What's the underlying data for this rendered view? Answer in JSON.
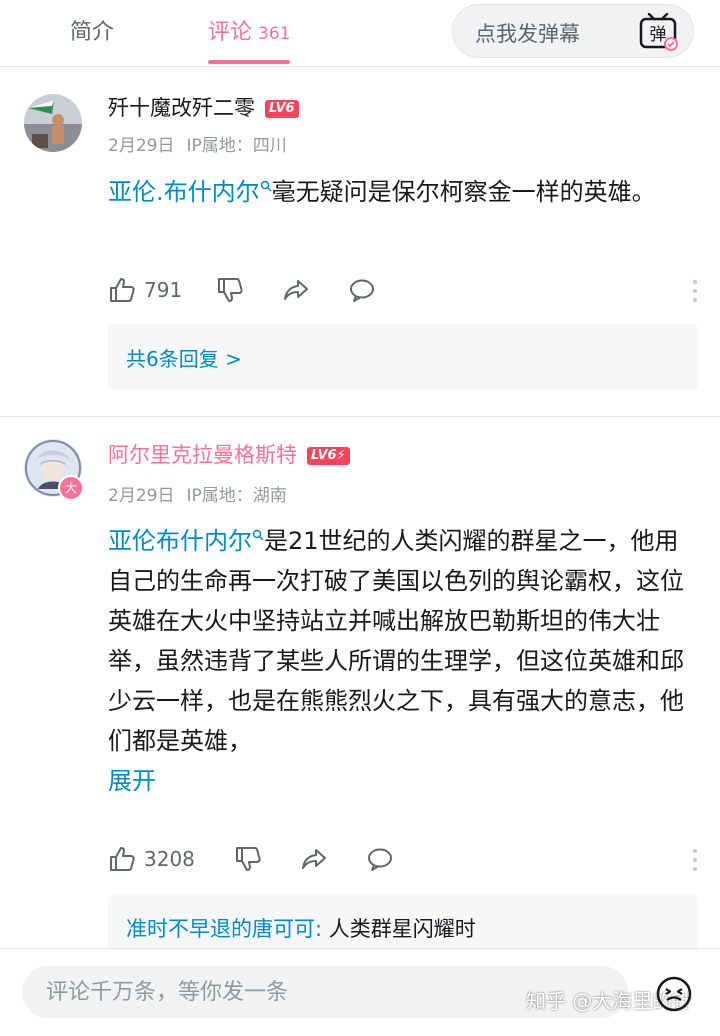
{
  "colors": {
    "accent": "#fb7299",
    "link": "#008ac5",
    "level_badge": "#f5455c"
  },
  "header": {
    "tabs": [
      {
        "label": "简介"
      },
      {
        "label": "评论",
        "count": "361"
      }
    ],
    "danmaku_placeholder": "点我发弹幕",
    "danmaku_icon": "弹"
  },
  "comments": [
    {
      "username": "歼十魔改歼二零",
      "level": "LV6",
      "date": "2月29日",
      "ip": "IP属地：四川",
      "link_text": "亚伦.布什内尔",
      "text": "毫无疑问是保尔柯察金一样的英雄。",
      "likes": "791",
      "replies_label": "共6条回复 >"
    },
    {
      "username": "阿尔里克拉曼格斯特",
      "level": "LV6⚡",
      "date": "2月29日",
      "ip": "IP属地：湖南",
      "link_text": "亚伦布什内尔",
      "text": "是21世纪的人类闪耀的群星之一，他用自己的生命再一次打破了美国以色列的舆论霸权，这位英雄在大火中坚持站立并喊出解放巴勒斯坦的伟大壮举，虽然违背了某些人所谓的生理学，但这位英雄和邱少云一样，也是在熊熊烈火之下，具有强大的意志，他们都是英雄，",
      "expand": "展开",
      "likes": "3208",
      "avatar_badge": "大",
      "reply_preview": {
        "user": "准时不早退的唐可可:",
        "text": " 人类群星闪耀时"
      }
    }
  ],
  "bottom": {
    "input_placeholder": "评论千万条，等你发一条",
    "watermark": "知乎 @大海里的针"
  }
}
